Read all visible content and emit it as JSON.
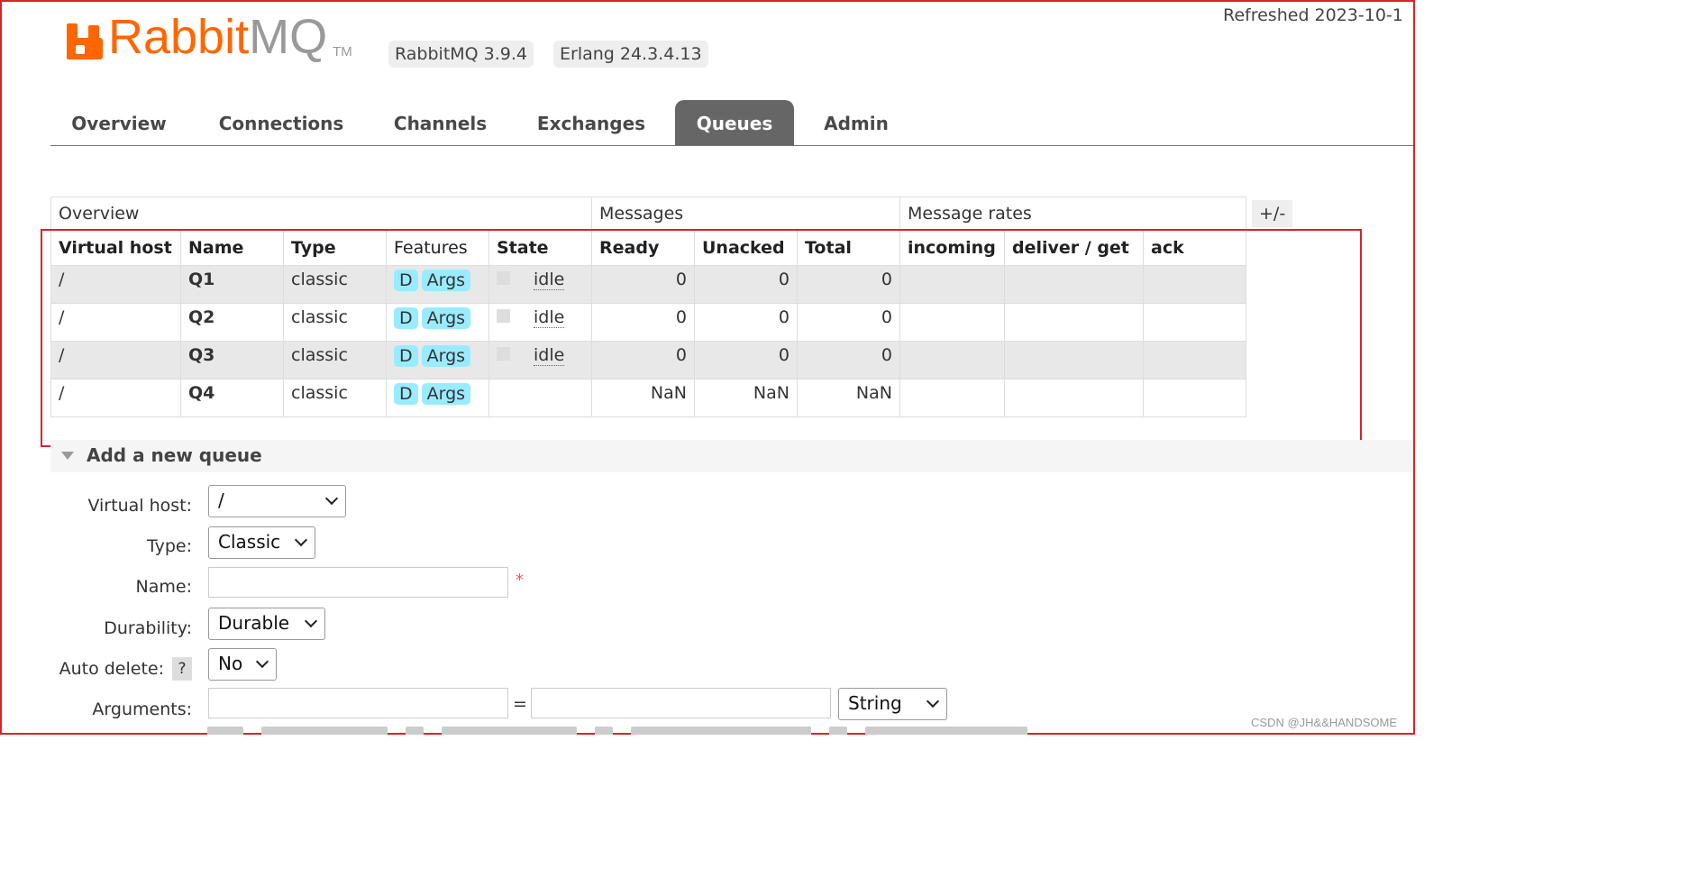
{
  "header": {
    "refreshed": "Refreshed 2023-10-1",
    "logo_rabbit": "Rabbit",
    "logo_mq": "MQ",
    "logo_tm": "TM",
    "version": "RabbitMQ 3.9.4",
    "erlang": "Erlang 24.3.4.13"
  },
  "nav": {
    "tabs": [
      "Overview",
      "Connections",
      "Channels",
      "Exchanges",
      "Queues",
      "Admin"
    ],
    "active": "Queues"
  },
  "table": {
    "groups": [
      "Overview",
      "Messages",
      "Message rates"
    ],
    "plus_minus": "+/-",
    "columns": [
      "Virtual host",
      "Name",
      "Type",
      "Features",
      "State",
      "Ready",
      "Unacked",
      "Total",
      "incoming",
      "deliver / get",
      "ack"
    ],
    "rows": [
      {
        "vhost": "/",
        "name": "Q1",
        "type": "classic",
        "f1": "D",
        "f2": "Args",
        "state": "idle",
        "ready": "0",
        "unacked": "0",
        "total": "0"
      },
      {
        "vhost": "/",
        "name": "Q2",
        "type": "classic",
        "f1": "D",
        "f2": "Args",
        "state": "idle",
        "ready": "0",
        "unacked": "0",
        "total": "0"
      },
      {
        "vhost": "/",
        "name": "Q3",
        "type": "classic",
        "f1": "D",
        "f2": "Args",
        "state": "idle",
        "ready": "0",
        "unacked": "0",
        "total": "0"
      },
      {
        "vhost": "/",
        "name": "Q4",
        "type": "classic",
        "f1": "D",
        "f2": "Args",
        "state": "",
        "ready": "NaN",
        "unacked": "NaN",
        "total": "NaN"
      }
    ]
  },
  "add_queue": {
    "title": "Add a new queue",
    "vhost_label": "Virtual host:",
    "vhost_value": "/",
    "type_label": "Type:",
    "type_value": "Classic",
    "name_label": "Name:",
    "name_value": "",
    "required_mark": "*",
    "durability_label": "Durability:",
    "durability_value": "Durable",
    "autodelete_label": "Auto delete:",
    "autodelete_help": "?",
    "autodelete_value": "No",
    "arguments_label": "Arguments:",
    "arguments_eq": "=",
    "arguments_type": "String"
  },
  "watermark": "CSDN @JH&&HANDSOME",
  "colors": {
    "accent": "#ff6600",
    "active_tab": "#666666",
    "feature_badge": "#99ebff",
    "highlight_border": "#d8232a"
  }
}
